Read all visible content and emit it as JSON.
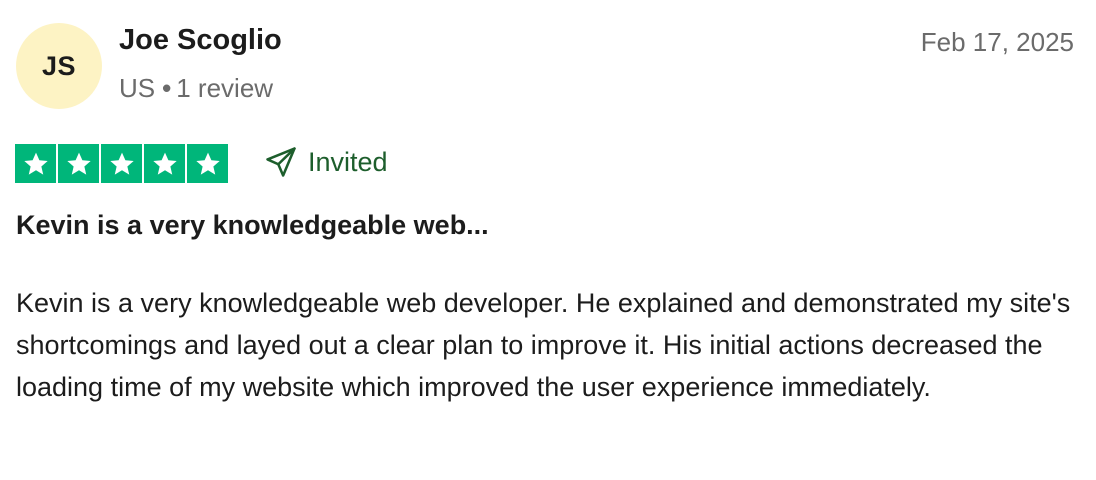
{
  "reviewer": {
    "initials": "JS",
    "name": "Joe Scoglio",
    "country": "US",
    "separator": "•",
    "review_count": "1 review"
  },
  "review": {
    "date": "Feb 17, 2025",
    "rating": 5,
    "rating_max": 5,
    "invited_label": "Invited",
    "title": "Kevin is a very knowledgeable web...",
    "body": "Kevin is a very knowledgeable web developer. He explained and demonstrated my site's shortcomings and layed out a clear plan to improve it. His initial actions decreased the loading time of my website which improved the user experience immediately."
  },
  "colors": {
    "star_green": "#00b67a",
    "invited_green": "#1d5e2c",
    "avatar_bg": "#fdf3c4",
    "muted_text": "#6b6b6b"
  },
  "icons": {
    "star": "star-icon",
    "invited": "paper-plane-icon"
  }
}
